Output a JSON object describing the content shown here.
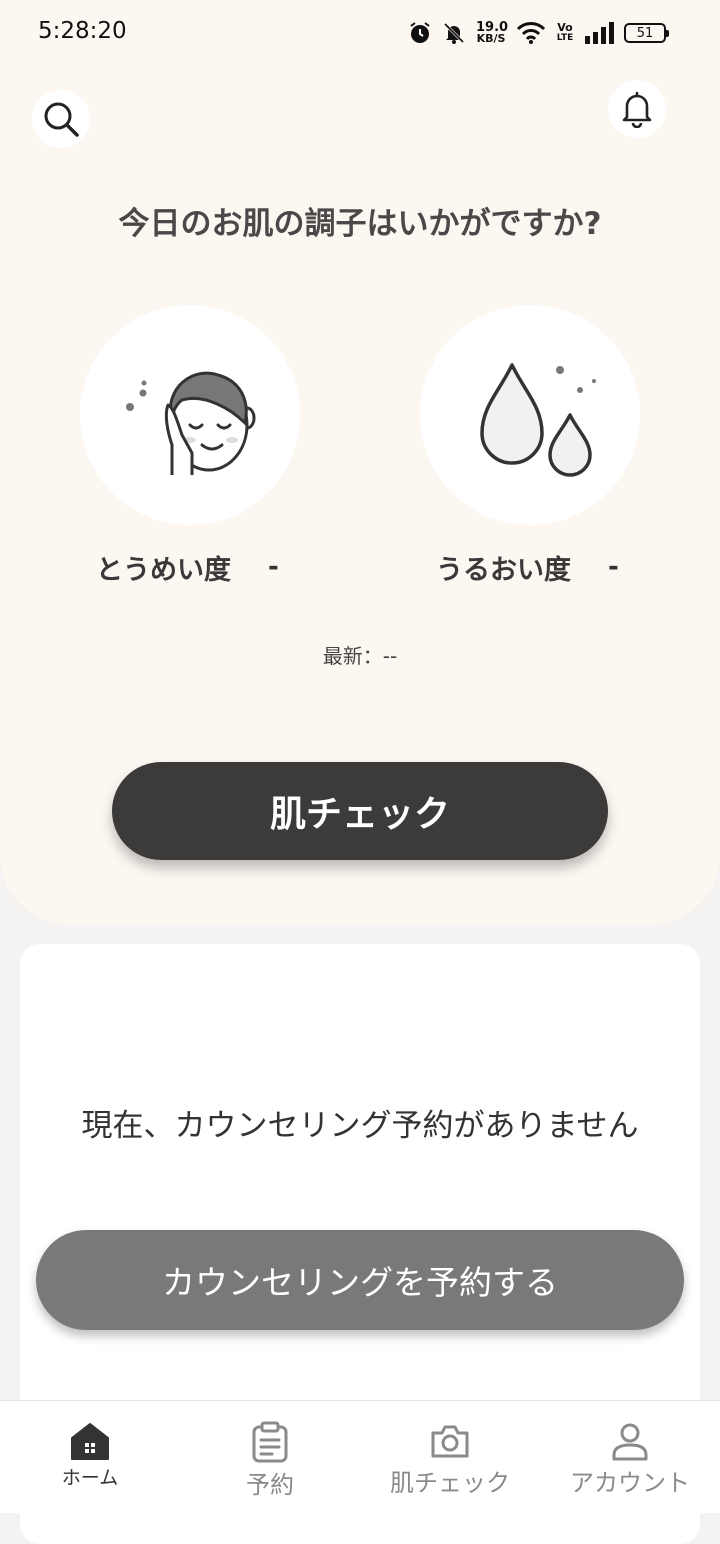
{
  "status_bar": {
    "time": "5:28:20",
    "net_speed_value": "19.0",
    "net_speed_unit": "KB/S",
    "volte_top": "Vo",
    "volte_bottom": "LTE",
    "battery": "51"
  },
  "header": {
    "search_icon": "search-icon",
    "bell_icon": "bell-icon"
  },
  "greeting": "今日のお肌の調子はいかがですか?",
  "metrics": [
    {
      "label": "とうめい度",
      "value": "-",
      "icon": "face-icon"
    },
    {
      "label": "うるおい度",
      "value": "-",
      "icon": "water-drops-icon"
    }
  ],
  "latest_text": "最新：--",
  "skin_check_button": "肌チェック",
  "reservation": {
    "empty_message": "現在、カウンセリング予約がありません",
    "book_button": "カウンセリングを予約する"
  },
  "bottom_nav": [
    {
      "label": "ホーム",
      "icon": "home-icon",
      "active": true
    },
    {
      "label": "予約",
      "icon": "clipboard-icon",
      "active": false
    },
    {
      "label": "肌チェック",
      "icon": "camera-icon",
      "active": false
    },
    {
      "label": "アカウント",
      "icon": "user-icon",
      "active": false
    }
  ],
  "colors": {
    "hero_bg": "#fdf7f2",
    "primary_button": "#3d3a3a",
    "secondary_button": "#7a7979"
  }
}
